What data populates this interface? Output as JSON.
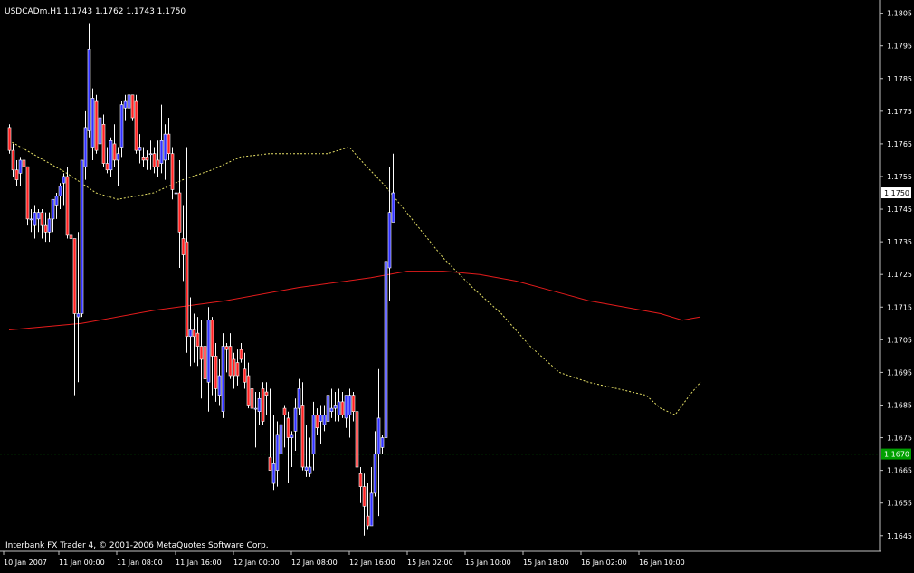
{
  "header": {
    "symbol": "USDCADm,H1",
    "ohlc": "1.1743 1.1762 1.1743 1.1750"
  },
  "footer": {
    "copyright": "Interbank FX Trader 4, © 2001-2006 MetaQuotes Software Corp."
  },
  "colors": {
    "background": "#000000",
    "frame": "#c0c0c0",
    "bull": "#3030ff",
    "bear": "#ff2020",
    "wick": "#ffffff",
    "ma_fast": "#e6e066",
    "ma_slow": "#e31b1b",
    "hline": "#00a000",
    "price_label_bg": "#ffffff",
    "hline_label_bg": "#00a000"
  },
  "chart_data": {
    "type": "candlestick",
    "y_ticks": [
      "1.1805",
      "1.1795",
      "1.1785",
      "1.1775",
      "1.1765",
      "1.1755",
      "1.1745",
      "1.1735",
      "1.1725",
      "1.1715",
      "1.1705",
      "1.1695",
      "1.1685",
      "1.1675",
      "1.1665",
      "1.1655",
      "1.1645"
    ],
    "ylim": [
      1.16405,
      1.18085
    ],
    "x_ticks": [
      "10 Jan 2007",
      "11 Jan 00:00",
      "11 Jan 08:00",
      "11 Jan 16:00",
      "12 Jan 00:00",
      "12 Jan 08:00",
      "12 Jan 16:00",
      "15 Jan 02:00",
      "15 Jan 10:00",
      "15 Jan 18:00",
      "16 Jan 02:00",
      "16 Jan 10:00"
    ],
    "current_price": "1.1750",
    "horizontal_line_price": "1.1670",
    "candles": [
      [
        1.177,
        1.1771,
        1.1762,
        1.1763
      ],
      [
        1.1763,
        1.1765,
        1.1755,
        1.1757
      ],
      [
        1.1757,
        1.176,
        1.1752,
        1.1754
      ],
      [
        1.1756,
        1.1761,
        1.1752,
        1.176
      ],
      [
        1.176,
        1.1762,
        1.1755,
        1.1758
      ],
      [
        1.1758,
        1.1758,
        1.174,
        1.1742
      ],
      [
        1.1742,
        1.1745,
        1.1738,
        1.1742
      ],
      [
        1.174,
        1.1746,
        1.1736,
        1.1744
      ],
      [
        1.1742,
        1.1745,
        1.1738,
        1.1744
      ],
      [
        1.1744,
        1.1745,
        1.1736,
        1.174
      ],
      [
        1.174,
        1.1744,
        1.1735,
        1.1738
      ],
      [
        1.1738,
        1.1744,
        1.1735,
        1.1742
      ],
      [
        1.1742,
        1.1748,
        1.1738,
        1.1748
      ],
      [
        1.1746,
        1.175,
        1.1742,
        1.1749
      ],
      [
        1.1749,
        1.1753,
        1.1745,
        1.1752
      ],
      [
        1.1753,
        1.1756,
        1.1746,
        1.1755
      ],
      [
        1.1755,
        1.1758,
        1.1736,
        1.1737
      ],
      [
        1.1737,
        1.174,
        1.1734,
        1.1736
      ],
      [
        1.1736,
        1.1736,
        1.1688,
        1.1713
      ],
      [
        1.1712,
        1.1738,
        1.1692,
        1.1713
      ],
      [
        1.1713,
        1.176,
        1.1712,
        1.176
      ],
      [
        1.1758,
        1.1775,
        1.1754,
        1.177
      ],
      [
        1.1769,
        1.1802,
        1.1767,
        1.1794
      ],
      [
        1.1764,
        1.1782,
        1.176,
        1.1779
      ],
      [
        1.1778,
        1.178,
        1.1762,
        1.1763
      ],
      [
        1.1765,
        1.1775,
        1.1756,
        1.1773
      ],
      [
        1.1771,
        1.1774,
        1.1758,
        1.1759
      ],
      [
        1.1759,
        1.1764,
        1.1756,
        1.1757
      ],
      [
        1.1757,
        1.1767,
        1.1755,
        1.1766
      ],
      [
        1.1765,
        1.1771,
        1.1758,
        1.176
      ],
      [
        1.176,
        1.1764,
        1.1752,
        1.1762
      ],
      [
        1.1764,
        1.1778,
        1.1761,
        1.1777
      ],
      [
        1.1776,
        1.178,
        1.1772,
        1.1778
      ],
      [
        1.1776,
        1.1782,
        1.1775,
        1.178
      ],
      [
        1.178,
        1.178,
        1.1772,
        1.1773
      ],
      [
        1.1778,
        1.178,
        1.1762,
        1.1763
      ],
      [
        1.1763,
        1.1768,
        1.1759,
        1.1764
      ],
      [
        1.1761,
        1.1764,
        1.1758,
        1.176
      ],
      [
        1.1761,
        1.1763,
        1.1757,
        1.176
      ],
      [
        1.1762,
        1.1766,
        1.1757,
        1.1762
      ],
      [
        1.1762,
        1.1764,
        1.1756,
        1.1758
      ],
      [
        1.176,
        1.1766,
        1.1755,
        1.1758
      ],
      [
        1.1759,
        1.1777,
        1.1756,
        1.1766
      ],
      [
        1.176,
        1.1771,
        1.1754,
        1.1768
      ],
      [
        1.1768,
        1.1773,
        1.176,
        1.1762
      ],
      [
        1.1762,
        1.1764,
        1.1748,
        1.1751
      ],
      [
        1.175,
        1.176,
        1.1736,
        1.175
      ],
      [
        1.175,
        1.176,
        1.1727,
        1.1738
      ],
      [
        1.1736,
        1.1746,
        1.1723,
        1.1731
      ],
      [
        1.1735,
        1.1764,
        1.1701,
        1.1706
      ],
      [
        1.1706,
        1.1718,
        1.1697,
        1.1708
      ],
      [
        1.1708,
        1.1713,
        1.1698,
        1.1706
      ],
      [
        1.1707,
        1.1712,
        1.1697,
        1.1703
      ],
      [
        1.1703,
        1.1711,
        1.1687,
        1.1699
      ],
      [
        1.1703,
        1.1715,
        1.1686,
        1.1693
      ],
      [
        1.1692,
        1.1715,
        1.1683,
        1.1711
      ],
      [
        1.1711,
        1.1712,
        1.1688,
        1.17
      ],
      [
        1.17,
        1.1704,
        1.1686,
        1.169
      ],
      [
        1.1688,
        1.1699,
        1.1685,
        1.1694
      ],
      [
        1.1683,
        1.1707,
        1.1681,
        1.1703
      ],
      [
        1.1703,
        1.1704,
        1.1695,
        1.1702
      ],
      [
        1.1703,
        1.1707,
        1.1693,
        1.1694
      ],
      [
        1.1699,
        1.1701,
        1.169,
        1.1694
      ],
      [
        1.1698,
        1.1702,
        1.1691,
        1.1694
      ],
      [
        1.1702,
        1.1704,
        1.1698,
        1.1699
      ],
      [
        1.1696,
        1.1701,
        1.169,
        1.1692
      ],
      [
        1.1694,
        1.1698,
        1.1684,
        1.1685
      ],
      [
        1.169,
        1.1692,
        1.1682,
        1.1684
      ],
      [
        1.1684,
        1.1689,
        1.1672,
        1.1684
      ],
      [
        1.1683,
        1.1689,
        1.1679,
        1.1687
      ],
      [
        1.169,
        1.1692,
        1.1679,
        1.168
      ],
      [
        1.1689,
        1.1692,
        1.1682,
        1.1688
      ],
      [
        1.1669,
        1.169,
        1.1665,
        1.1665
      ],
      [
        1.1661,
        1.1682,
        1.1659,
        1.1667
      ],
      [
        1.1665,
        1.168,
        1.166,
        1.1676
      ],
      [
        1.167,
        1.1684,
        1.1669,
        1.1679
      ],
      [
        1.1684,
        1.1685,
        1.1672,
        1.1682
      ],
      [
        1.1681,
        1.1683,
        1.1661,
        1.1675
      ],
      [
        1.1675,
        1.1677,
        1.1666,
        1.1676
      ],
      [
        1.1677,
        1.1687,
        1.1671,
        1.1684
      ],
      [
        1.1684,
        1.1693,
        1.1682,
        1.169
      ],
      [
        1.1685,
        1.1692,
        1.1665,
        1.1666
      ],
      [
        1.1665,
        1.1679,
        1.1663,
        1.1666
      ],
      [
        1.1664,
        1.1675,
        1.1663,
        1.1666
      ],
      [
        1.167,
        1.1686,
        1.1665,
        1.1682
      ],
      [
        1.1682,
        1.1684,
        1.1676,
        1.1678
      ],
      [
        1.168,
        1.1685,
        1.1673,
        1.1682
      ],
      [
        1.1679,
        1.1685,
        1.1677,
        1.1682
      ],
      [
        1.168,
        1.1689,
        1.1673,
        1.1688
      ],
      [
        1.1683,
        1.169,
        1.1681,
        1.1684
      ],
      [
        1.1684,
        1.1689,
        1.168,
        1.1685
      ],
      [
        1.1682,
        1.169,
        1.168,
        1.1686
      ],
      [
        1.1686,
        1.1689,
        1.1681,
        1.1682
      ],
      [
        1.1681,
        1.1688,
        1.1678,
        1.1688
      ],
      [
        1.1682,
        1.169,
        1.1675,
        1.1688
      ],
      [
        1.1688,
        1.1689,
        1.168,
        1.1683
      ],
      [
        1.1683,
        1.1685,
        1.1664,
        1.1666
      ],
      [
        1.1664,
        1.1666,
        1.1655,
        1.166
      ],
      [
        1.166,
        1.1664,
        1.1645,
        1.1654
      ],
      [
        1.1651,
        1.1661,
        1.1647,
        1.1648
      ],
      [
        1.1648,
        1.1666,
        1.1648,
        1.1658
      ],
      [
        1.1658,
        1.1677,
        1.1657,
        1.167
      ],
      [
        1.167,
        1.1696,
        1.1651,
        1.1681
      ],
      [
        1.1672,
        1.1676,
        1.167,
        1.1675
      ],
      [
        1.1675,
        1.1732,
        1.1675,
        1.1729
      ],
      [
        1.1727,
        1.1758,
        1.1717,
        1.1744
      ],
      [
        1.1741,
        1.1762,
        1.1741,
        1.175
      ]
    ],
    "ma_fast": [
      [
        0,
        1.1766
      ],
      [
        8,
        1.1761
      ],
      [
        16,
        1.1756
      ],
      [
        24,
        1.175
      ],
      [
        30,
        1.1748
      ],
      [
        40,
        1.175
      ],
      [
        48,
        1.1754
      ],
      [
        56,
        1.1757
      ],
      [
        64,
        1.1761
      ],
      [
        72,
        1.1762
      ],
      [
        80,
        1.1762
      ],
      [
        88,
        1.1762
      ],
      [
        94,
        1.1764
      ],
      [
        98,
        1.1759
      ],
      [
        104,
        1.1752
      ],
      [
        112,
        1.1741
      ],
      [
        120,
        1.173
      ],
      [
        128,
        1.1721
      ],
      [
        136,
        1.1713
      ],
      [
        144,
        1.1703
      ],
      [
        152,
        1.1695
      ],
      [
        160,
        1.1692
      ],
      [
        168,
        1.169
      ],
      [
        176,
        1.1688
      ],
      [
        180,
        1.1684
      ],
      [
        184,
        1.1682
      ],
      [
        188,
        1.1688
      ],
      [
        191,
        1.1692
      ]
    ],
    "ma_slow": [
      [
        0,
        1.1708
      ],
      [
        20,
        1.171
      ],
      [
        40,
        1.1714
      ],
      [
        60,
        1.1717
      ],
      [
        80,
        1.1721
      ],
      [
        100,
        1.1724
      ],
      [
        110,
        1.1726
      ],
      [
        120,
        1.1726
      ],
      [
        130,
        1.1725
      ],
      [
        140,
        1.1723
      ],
      [
        150,
        1.172
      ],
      [
        160,
        1.1717
      ],
      [
        170,
        1.1715
      ],
      [
        180,
        1.1713
      ],
      [
        186,
        1.1711
      ],
      [
        191,
        1.1712
      ]
    ]
  }
}
